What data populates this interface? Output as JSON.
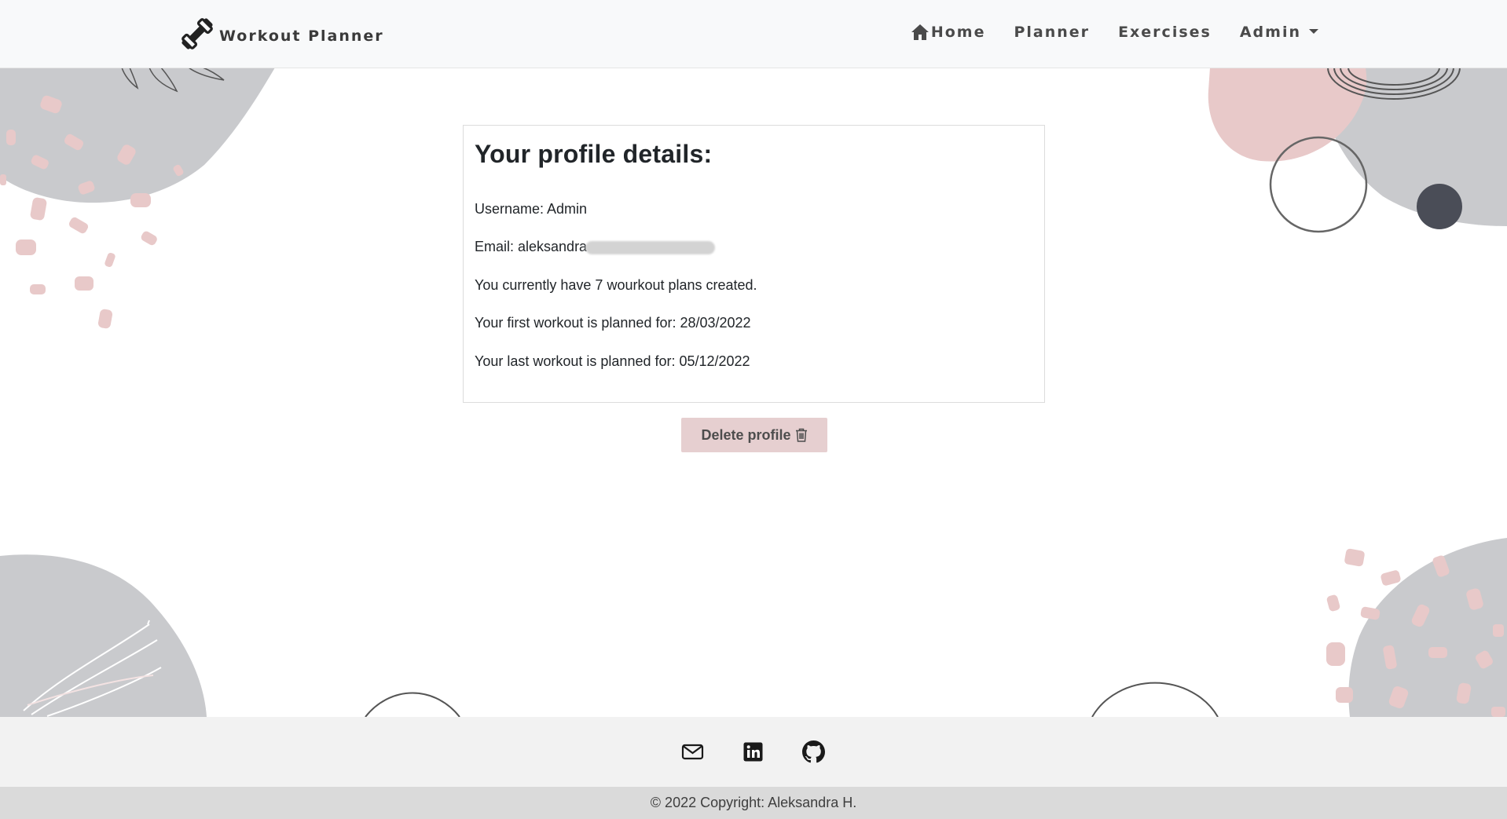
{
  "app": {
    "brand": "Workout Planner",
    "accent_color": "#e6cfd0"
  },
  "nav": {
    "items": [
      {
        "label": "Home",
        "icon": "home-icon"
      },
      {
        "label": "Planner"
      },
      {
        "label": "Exercises"
      },
      {
        "label": "Admin",
        "icon": "caret-down-icon"
      }
    ]
  },
  "profile": {
    "heading": "Your profile details:",
    "username_line": "Username: Admin",
    "email_line": "Email: aleksandra",
    "plans_line": "You currently have 7 wourkout plans created.",
    "first_workout_line": "Your first workout is planned for: 28/03/2022",
    "last_workout_line": "Your last workout is planned for: 05/12/2022"
  },
  "actions": {
    "delete_label": "Delete profile",
    "delete_icon": "trash-icon"
  },
  "footer": {
    "social_icons": [
      "envelope-icon",
      "linkedin-icon",
      "github-icon"
    ],
    "copyright": "© 2022 Copyright: Aleksandra H."
  }
}
